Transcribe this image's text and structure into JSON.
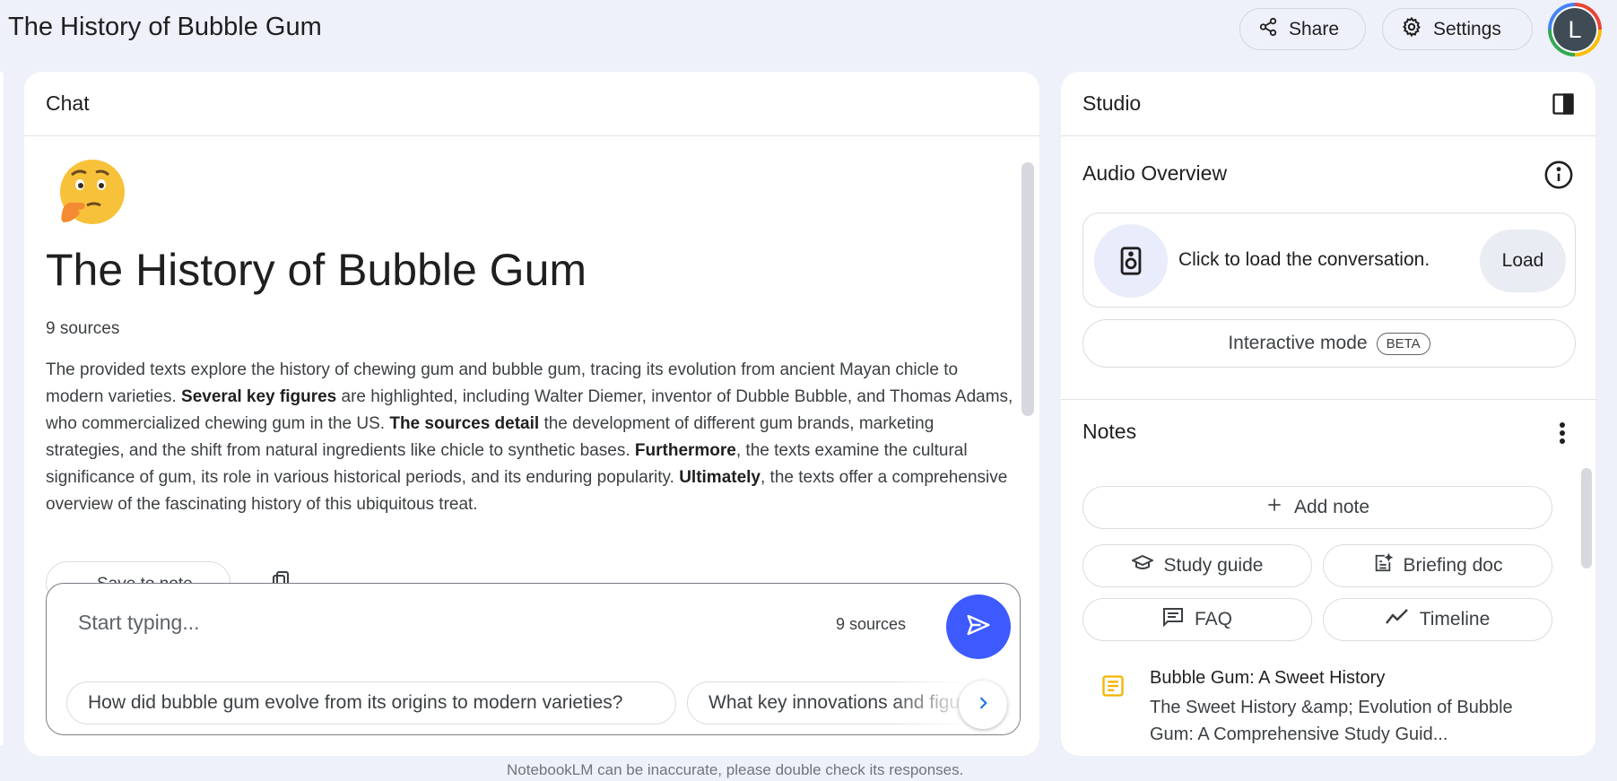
{
  "header": {
    "title": "The History of Bubble Gum",
    "share_label": "Share",
    "settings_label": "Settings",
    "avatar_initial": "L"
  },
  "chat": {
    "panel_title": "Chat",
    "notebook_title": "The History of Bubble Gum",
    "sources_count": "9 sources",
    "summary": [
      {
        "text": "The provided texts explore the history of chewing gum and bubble gum, tracing its evolution from ancient Mayan chicle to modern varieties. ",
        "bold": false
      },
      {
        "text": "Several key figures",
        "bold": true
      },
      {
        "text": " are highlighted, including Walter Diemer, inventor of Dubble Bubble, and Thomas Adams, who commercialized chewing gum in the US. ",
        "bold": false
      },
      {
        "text": "The sources detail",
        "bold": true
      },
      {
        "text": " the development of different gum brands, marketing strategies, and the shift from natural ingredients like chicle to synthetic bases. ",
        "bold": false
      },
      {
        "text": "Furthermore",
        "bold": true
      },
      {
        "text": ", the texts examine the cultural significance of gum, its role in various historical periods, and its enduring popularity. ",
        "bold": false
      },
      {
        "text": "Ultimately",
        "bold": true
      },
      {
        "text": ", the texts offer a comprehensive overview of the fascinating history of this ubiquitous treat.",
        "bold": false
      }
    ],
    "save_to_note_label": "Save to note",
    "input_placeholder": "Start typing...",
    "input_sources": "9 sources",
    "suggestions": [
      "How did bubble gum evolve from its origins to modern varieties?",
      "What key innovations and figures shaped bubble gum's history?"
    ],
    "disclaimer": "NotebookLM can be inaccurate, please double check its responses."
  },
  "studio": {
    "panel_title": "Studio",
    "audio_overview_title": "Audio Overview",
    "audio_prompt": "Click to load the conversation.",
    "load_label": "Load",
    "interactive_label": "Interactive mode",
    "beta_label": "BETA",
    "notes_title": "Notes",
    "add_note_label": "Add note",
    "study_guide_label": "Study guide",
    "briefing_doc_label": "Briefing doc",
    "faq_label": "FAQ",
    "timeline_label": "Timeline",
    "note": {
      "title": "Bubble Gum: A Sweet History",
      "body": "The Sweet History &amp; Evolution of Bubble Gum: A Comprehensive Study Guid..."
    }
  },
  "colors": {
    "background": "#eef0fa",
    "send_button": "#3d5afe",
    "note_icon": "#f4b400"
  }
}
